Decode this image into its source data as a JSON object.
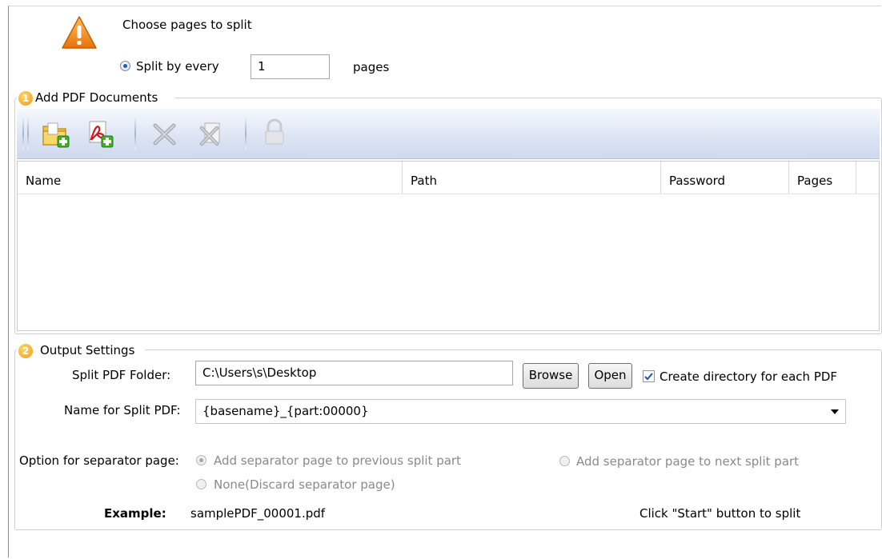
{
  "header": {
    "title": "Choose pages to split",
    "split_option_label": "Split by every",
    "split_value": "1",
    "split_unit": "pages"
  },
  "documents": {
    "section_number": "1",
    "section_title": "Add PDF Documents",
    "toolbar": {
      "icons": [
        "add-folder-icon",
        "add-pdf-icon",
        "remove-icon",
        "remove-all-icon",
        "lock-icon"
      ]
    },
    "columns": [
      "Name",
      "Path",
      "Password",
      "Pages"
    ],
    "rows": []
  },
  "output": {
    "section_number": "2",
    "section_title": "Output Settings",
    "folder_label": "Split PDF Folder:",
    "folder_value": "C:\\Users\\s\\Desktop",
    "browse_label": "Browse",
    "open_label": "Open",
    "create_dir_label": "Create directory for each PDF",
    "create_dir_checked": true,
    "name_label": "Name for Split PDF:",
    "name_value": "{basename}_{part:00000}",
    "separator_label": "Option for separator page:",
    "separator_previous": "Add separator page to previous split part",
    "separator_next": "Add separator page to next split part",
    "separator_none": "None(Discard separator page)",
    "example_label": "Example:",
    "example_value": "samplePDF_00001.pdf",
    "hint": "Click \"Start\" button to split"
  },
  "colors": {
    "toolbar_bg": "#dde5f4",
    "badge": "#f29a0f",
    "disabled_text": "#8a8a8a"
  }
}
